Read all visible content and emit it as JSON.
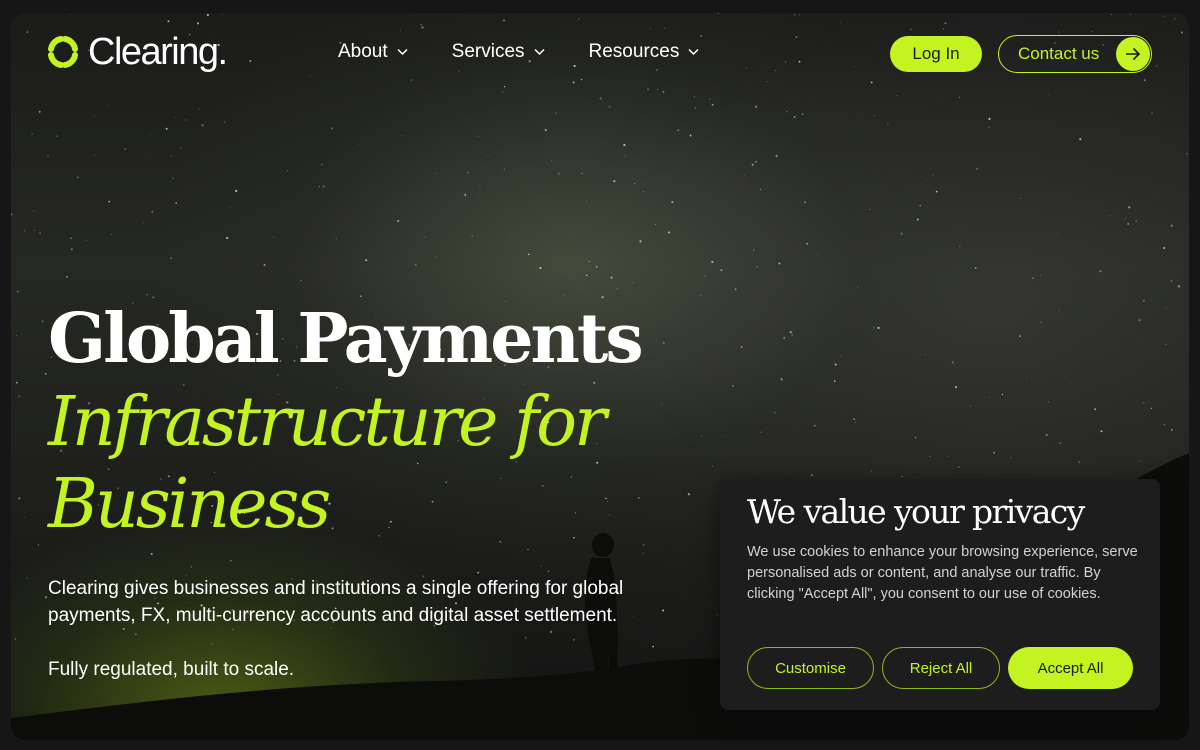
{
  "brand": {
    "name": "Clearing."
  },
  "nav": {
    "items": [
      {
        "label": "About"
      },
      {
        "label": "Services"
      },
      {
        "label": "Resources"
      }
    ],
    "login_label": "Log In",
    "contact_label": "Contact us"
  },
  "hero": {
    "title_line1": "Global Payments",
    "title_accent": "Infrastructure for Business",
    "description": "Clearing gives businesses and institutions a single offering for global payments, FX, multi-currency accounts and digital asset settlement.",
    "tagline": "Fully regulated, built to scale."
  },
  "cookie": {
    "title": "We value your privacy",
    "text": "We use cookies to enhance your browsing experience, serve personalised ads or content, and analyse our traffic. By clicking \"Accept All\", you consent to our use of cookies.",
    "customise_label": "Customise",
    "reject_label": "Reject All",
    "accept_label": "Accept All"
  },
  "colors": {
    "accent": "#c3f321",
    "background": "#161616",
    "panel": "#1d1d1d"
  },
  "icons": {
    "logo": "clearing-logo-mark",
    "nav_dropdown": "chevron-down-icon",
    "contact": "arrow-right-icon"
  }
}
